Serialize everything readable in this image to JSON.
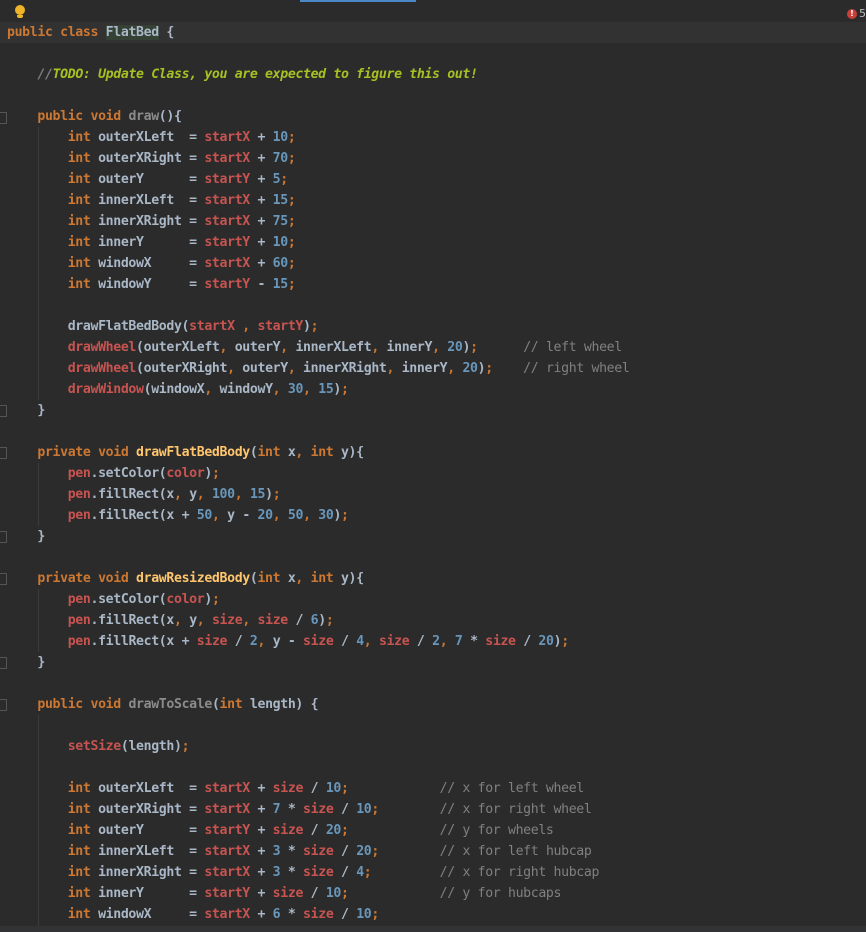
{
  "editor": {
    "problems": {
      "errors": "5",
      "error_icon": "error-circle-icon"
    },
    "intention_icon": "lightbulb-icon",
    "lines": [
      [
        [
          "kw",
          "public class "
        ],
        [
          "cls",
          "FlatBed"
        ],
        [
          "id",
          " {"
        ]
      ],
      [],
      [
        [
          "id",
          "    "
        ],
        [
          "todos",
          "//"
        ],
        [
          "todo",
          "TODO: Update Class, you are expected to figure this out!"
        ]
      ],
      [],
      [
        [
          "id",
          "    "
        ],
        [
          "kw",
          "public void "
        ],
        [
          "fnu",
          "draw"
        ],
        [
          "id",
          "(){"
        ]
      ],
      [
        [
          "id",
          "        "
        ],
        [
          "kw",
          "int "
        ],
        [
          "id",
          "outerXLeft  = "
        ],
        [
          "fld",
          "startX"
        ],
        [
          "id",
          " + "
        ],
        [
          "num",
          "10"
        ],
        [
          "pun",
          ";"
        ]
      ],
      [
        [
          "id",
          "        "
        ],
        [
          "kw",
          "int "
        ],
        [
          "id",
          "outerXRight = "
        ],
        [
          "fld",
          "startX"
        ],
        [
          "id",
          " + "
        ],
        [
          "num",
          "70"
        ],
        [
          "pun",
          ";"
        ]
      ],
      [
        [
          "id",
          "        "
        ],
        [
          "kw",
          "int "
        ],
        [
          "id",
          "outerY      = "
        ],
        [
          "fld",
          "startY"
        ],
        [
          "id",
          " + "
        ],
        [
          "num",
          "5"
        ],
        [
          "pun",
          ";"
        ]
      ],
      [
        [
          "id",
          "        "
        ],
        [
          "kw",
          "int "
        ],
        [
          "id",
          "innerXLeft  = "
        ],
        [
          "fld",
          "startX"
        ],
        [
          "id",
          " + "
        ],
        [
          "num",
          "15"
        ],
        [
          "pun",
          ";"
        ]
      ],
      [
        [
          "id",
          "        "
        ],
        [
          "kw",
          "int "
        ],
        [
          "id",
          "innerXRight = "
        ],
        [
          "fld",
          "startX"
        ],
        [
          "id",
          " + "
        ],
        [
          "num",
          "75"
        ],
        [
          "pun",
          ";"
        ]
      ],
      [
        [
          "id",
          "        "
        ],
        [
          "kw",
          "int "
        ],
        [
          "id",
          "innerY      = "
        ],
        [
          "fld",
          "startY"
        ],
        [
          "id",
          " + "
        ],
        [
          "num",
          "10"
        ],
        [
          "pun",
          ";"
        ]
      ],
      [
        [
          "id",
          "        "
        ],
        [
          "kw",
          "int "
        ],
        [
          "id",
          "windowX     = "
        ],
        [
          "fld",
          "startX"
        ],
        [
          "id",
          " + "
        ],
        [
          "num",
          "60"
        ],
        [
          "pun",
          ";"
        ]
      ],
      [
        [
          "id",
          "        "
        ],
        [
          "kw",
          "int "
        ],
        [
          "id",
          "windowY     = "
        ],
        [
          "fld",
          "startY"
        ],
        [
          "id",
          " - "
        ],
        [
          "num",
          "15"
        ],
        [
          "pun",
          ";"
        ]
      ],
      [],
      [
        [
          "id",
          "        drawFlatBedBody("
        ],
        [
          "fld",
          "startX"
        ],
        [
          "pun",
          " , "
        ],
        [
          "fld",
          "startY"
        ],
        [
          "id",
          ")"
        ],
        [
          "pun",
          ";"
        ]
      ],
      [
        [
          "id",
          "        "
        ],
        [
          "fld",
          "drawWheel"
        ],
        [
          "id",
          "(outerXLeft"
        ],
        [
          "pun",
          ", "
        ],
        [
          "id",
          "outerY"
        ],
        [
          "pun",
          ", "
        ],
        [
          "id",
          "innerXLeft"
        ],
        [
          "pun",
          ", "
        ],
        [
          "id",
          "innerY"
        ],
        [
          "pun",
          ", "
        ],
        [
          "num",
          "20"
        ],
        [
          "id",
          ")"
        ],
        [
          "pun",
          ";"
        ],
        [
          "cm",
          "      // left wheel"
        ]
      ],
      [
        [
          "id",
          "        "
        ],
        [
          "fld",
          "drawWheel"
        ],
        [
          "id",
          "(outerXRight"
        ],
        [
          "pun",
          ", "
        ],
        [
          "id",
          "outerY"
        ],
        [
          "pun",
          ", "
        ],
        [
          "id",
          "innerXRight"
        ],
        [
          "pun",
          ", "
        ],
        [
          "id",
          "innerY"
        ],
        [
          "pun",
          ", "
        ],
        [
          "num",
          "20"
        ],
        [
          "id",
          ")"
        ],
        [
          "pun",
          ";"
        ],
        [
          "cm",
          "    // right wheel"
        ]
      ],
      [
        [
          "id",
          "        "
        ],
        [
          "fld",
          "drawWindow"
        ],
        [
          "id",
          "(windowX"
        ],
        [
          "pun",
          ", "
        ],
        [
          "id",
          "windowY"
        ],
        [
          "pun",
          ", "
        ],
        [
          "num",
          "30"
        ],
        [
          "pun",
          ", "
        ],
        [
          "num",
          "15"
        ],
        [
          "id",
          ")"
        ],
        [
          "pun",
          ";"
        ]
      ],
      [
        [
          "id",
          "    }"
        ]
      ],
      [],
      [
        [
          "id",
          "    "
        ],
        [
          "kw",
          "private void "
        ],
        [
          "fn",
          "drawFlatBedBody"
        ],
        [
          "id",
          "("
        ],
        [
          "kw",
          "int "
        ],
        [
          "id",
          "x"
        ],
        [
          "pun",
          ", "
        ],
        [
          "kw",
          "int "
        ],
        [
          "id",
          "y){"
        ]
      ],
      [
        [
          "id",
          "        "
        ],
        [
          "fld",
          "pen"
        ],
        [
          "id",
          ".setColor("
        ],
        [
          "fld",
          "color"
        ],
        [
          "id",
          ")"
        ],
        [
          "pun",
          ";"
        ]
      ],
      [
        [
          "id",
          "        "
        ],
        [
          "fld",
          "pen"
        ],
        [
          "id",
          ".fillRect(x"
        ],
        [
          "pun",
          ", "
        ],
        [
          "id",
          "y"
        ],
        [
          "pun",
          ", "
        ],
        [
          "num",
          "100"
        ],
        [
          "pun",
          ", "
        ],
        [
          "num",
          "15"
        ],
        [
          "id",
          ")"
        ],
        [
          "pun",
          ";"
        ]
      ],
      [
        [
          "id",
          "        "
        ],
        [
          "fld",
          "pen"
        ],
        [
          "id",
          ".fillRect(x + "
        ],
        [
          "num",
          "50"
        ],
        [
          "pun",
          ", "
        ],
        [
          "id",
          "y - "
        ],
        [
          "num",
          "20"
        ],
        [
          "pun",
          ", "
        ],
        [
          "num",
          "50"
        ],
        [
          "pun",
          ", "
        ],
        [
          "num",
          "30"
        ],
        [
          "id",
          ")"
        ],
        [
          "pun",
          ";"
        ]
      ],
      [
        [
          "id",
          "    }"
        ]
      ],
      [],
      [
        [
          "id",
          "    "
        ],
        [
          "kw",
          "private void "
        ],
        [
          "fn",
          "drawResizedBody"
        ],
        [
          "id",
          "("
        ],
        [
          "kw",
          "int "
        ],
        [
          "id",
          "x"
        ],
        [
          "pun",
          ", "
        ],
        [
          "kw",
          "int "
        ],
        [
          "id",
          "y){"
        ]
      ],
      [
        [
          "id",
          "        "
        ],
        [
          "fld",
          "pen"
        ],
        [
          "id",
          ".setColor("
        ],
        [
          "fld",
          "color"
        ],
        [
          "id",
          ")"
        ],
        [
          "pun",
          ";"
        ]
      ],
      [
        [
          "id",
          "        "
        ],
        [
          "fld",
          "pen"
        ],
        [
          "id",
          ".fillRect(x"
        ],
        [
          "pun",
          ", "
        ],
        [
          "id",
          "y"
        ],
        [
          "pun",
          ", "
        ],
        [
          "fld",
          "size"
        ],
        [
          "pun",
          ", "
        ],
        [
          "fld",
          "size"
        ],
        [
          "id",
          " / "
        ],
        [
          "num",
          "6"
        ],
        [
          "id",
          ")"
        ],
        [
          "pun",
          ";"
        ]
      ],
      [
        [
          "id",
          "        "
        ],
        [
          "fld",
          "pen"
        ],
        [
          "id",
          ".fillRect(x + "
        ],
        [
          "fld",
          "size"
        ],
        [
          "id",
          " / "
        ],
        [
          "num",
          "2"
        ],
        [
          "pun",
          ", "
        ],
        [
          "id",
          "y - "
        ],
        [
          "fld",
          "size"
        ],
        [
          "id",
          " / "
        ],
        [
          "num",
          "4"
        ],
        [
          "pun",
          ", "
        ],
        [
          "fld",
          "size"
        ],
        [
          "id",
          " / "
        ],
        [
          "num",
          "2"
        ],
        [
          "pun",
          ", "
        ],
        [
          "num",
          "7"
        ],
        [
          "id",
          " * "
        ],
        [
          "fld",
          "size"
        ],
        [
          "id",
          " / "
        ],
        [
          "num",
          "20"
        ],
        [
          "id",
          ")"
        ],
        [
          "pun",
          ";"
        ]
      ],
      [
        [
          "id",
          "    }"
        ]
      ],
      [],
      [
        [
          "id",
          "    "
        ],
        [
          "kw",
          "public void "
        ],
        [
          "fnu",
          "drawToScale"
        ],
        [
          "id",
          "("
        ],
        [
          "kw",
          "int "
        ],
        [
          "id",
          "length) {"
        ]
      ],
      [],
      [
        [
          "id",
          "        "
        ],
        [
          "fld",
          "setSize"
        ],
        [
          "id",
          "(length)"
        ],
        [
          "pun",
          ";"
        ]
      ],
      [],
      [
        [
          "id",
          "        "
        ],
        [
          "kw",
          "int "
        ],
        [
          "id",
          "outerXLeft  = "
        ],
        [
          "fld",
          "startX"
        ],
        [
          "id",
          " + "
        ],
        [
          "fld",
          "size"
        ],
        [
          "id",
          " / "
        ],
        [
          "num",
          "10"
        ],
        [
          "pun",
          ";"
        ],
        [
          "cm",
          "            // x for left wheel"
        ]
      ],
      [
        [
          "id",
          "        "
        ],
        [
          "kw",
          "int "
        ],
        [
          "id",
          "outerXRight = "
        ],
        [
          "fld",
          "startX"
        ],
        [
          "id",
          " + "
        ],
        [
          "num",
          "7"
        ],
        [
          "id",
          " * "
        ],
        [
          "fld",
          "size"
        ],
        [
          "id",
          " / "
        ],
        [
          "num",
          "10"
        ],
        [
          "pun",
          ";"
        ],
        [
          "cm",
          "        // x for right wheel"
        ]
      ],
      [
        [
          "id",
          "        "
        ],
        [
          "kw",
          "int "
        ],
        [
          "id",
          "outerY      = "
        ],
        [
          "fld",
          "startY"
        ],
        [
          "id",
          " + "
        ],
        [
          "fld",
          "size"
        ],
        [
          "id",
          " / "
        ],
        [
          "num",
          "20"
        ],
        [
          "pun",
          ";"
        ],
        [
          "cm",
          "            // y for wheels"
        ]
      ],
      [
        [
          "id",
          "        "
        ],
        [
          "kw",
          "int "
        ],
        [
          "id",
          "innerXLeft  = "
        ],
        [
          "fld",
          "startX"
        ],
        [
          "id",
          " + "
        ],
        [
          "num",
          "3"
        ],
        [
          "id",
          " * "
        ],
        [
          "fld",
          "size"
        ],
        [
          "id",
          " / "
        ],
        [
          "num",
          "20"
        ],
        [
          "pun",
          ";"
        ],
        [
          "cm",
          "        // x for left hubcap"
        ]
      ],
      [
        [
          "id",
          "        "
        ],
        [
          "kw",
          "int "
        ],
        [
          "id",
          "innerXRight = "
        ],
        [
          "fld",
          "startX"
        ],
        [
          "id",
          " + "
        ],
        [
          "num",
          "3"
        ],
        [
          "id",
          " * "
        ],
        [
          "fld",
          "size"
        ],
        [
          "id",
          " / "
        ],
        [
          "num",
          "4"
        ],
        [
          "pun",
          ";"
        ],
        [
          "cm",
          "         // x for right hubcap"
        ]
      ],
      [
        [
          "id",
          "        "
        ],
        [
          "kw",
          "int "
        ],
        [
          "id",
          "innerY      = "
        ],
        [
          "fld",
          "startY"
        ],
        [
          "id",
          " + "
        ],
        [
          "fld",
          "size"
        ],
        [
          "id",
          " / "
        ],
        [
          "num",
          "10"
        ],
        [
          "pun",
          ";"
        ],
        [
          "cm",
          "            // y for hubcaps"
        ]
      ],
      [
        [
          "id",
          "        "
        ],
        [
          "kw",
          "int "
        ],
        [
          "id",
          "windowX     = "
        ],
        [
          "fld",
          "startX"
        ],
        [
          "id",
          " + "
        ],
        [
          "num",
          "6"
        ],
        [
          "id",
          " * "
        ],
        [
          "fld",
          "size"
        ],
        [
          "id",
          " / "
        ],
        [
          "num",
          "10"
        ],
        [
          "pun",
          ";"
        ]
      ]
    ]
  }
}
